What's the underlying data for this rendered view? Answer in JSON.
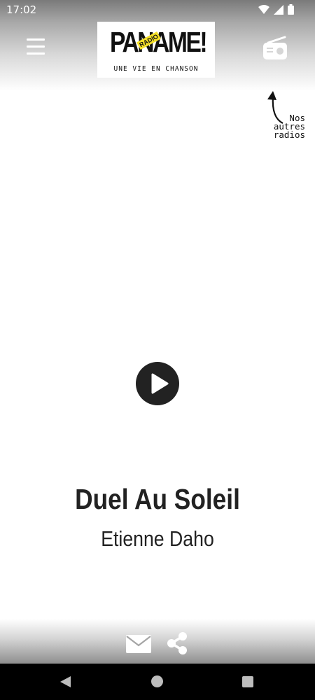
{
  "status_bar": {
    "time": "17:02"
  },
  "header": {
    "menu_icon": "hamburger-menu-icon",
    "logo": {
      "name": "PANAME!",
      "badge": "RADIO",
      "tagline": "UNE VIE EN CHANSON"
    },
    "radio_icon": "radio-icon"
  },
  "other_radios": {
    "label_line1": "Nos",
    "label_line2": "autres",
    "label_line3": "radios",
    "arrow_icon": "curved-arrow-up-icon"
  },
  "player": {
    "play_icon": "play-icon",
    "title": "Duel Au Soleil",
    "artist": "Etienne Daho"
  },
  "footer": {
    "mail_icon": "mail-icon",
    "share_icon": "share-icon"
  },
  "nav_bar": {
    "back_icon": "back-triangle-icon",
    "home_icon": "home-circle-icon",
    "recents_icon": "recents-square-icon"
  },
  "colors": {
    "logo_badge": "#f5e028",
    "text_dark": "#222222",
    "nav_bar": "#000000"
  }
}
